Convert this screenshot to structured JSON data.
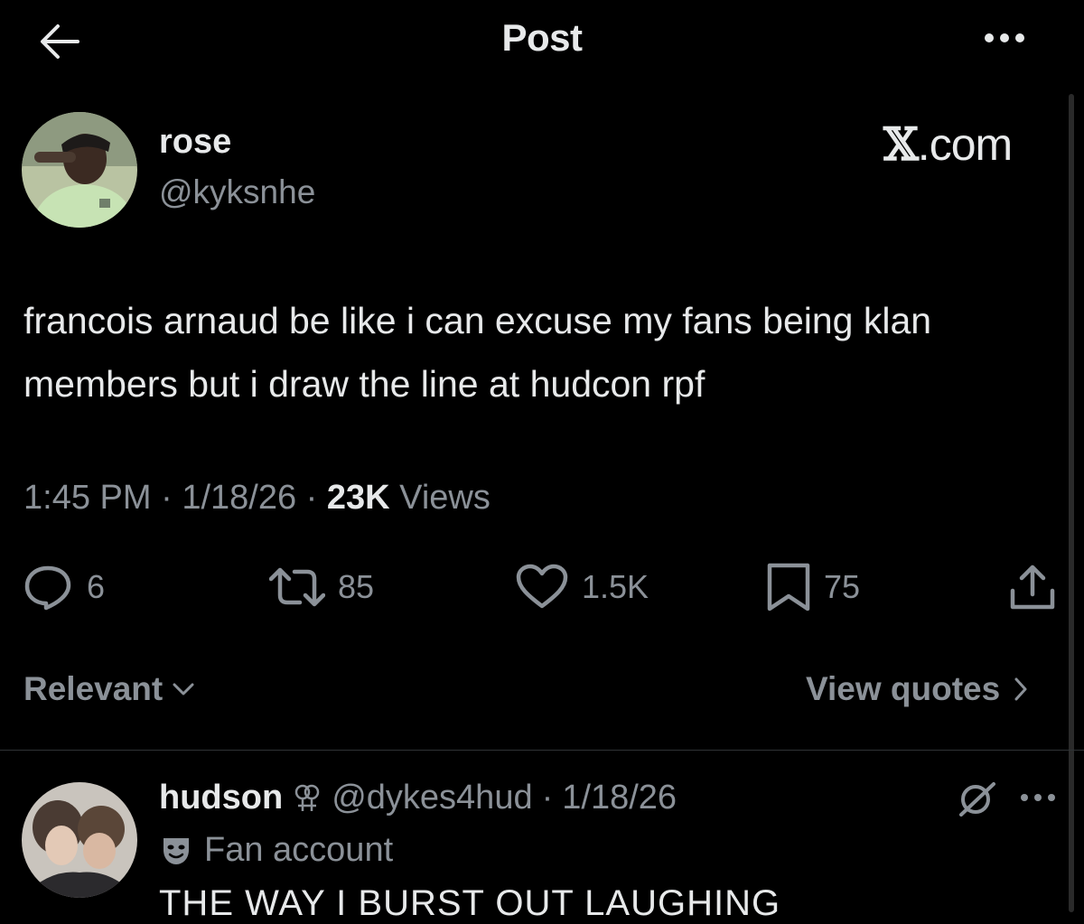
{
  "header": {
    "title": "Post"
  },
  "post": {
    "author_name": "rose",
    "author_handle": "@kyksnhe",
    "watermark": "X.com",
    "text": "francois arnaud be like i can excuse my fans being klan members but i draw the line at hudcon rpf",
    "time": "1:45 PM",
    "date": "1/18/26",
    "views_count": "23K",
    "views_label": "Views",
    "sep": "·",
    "actions": {
      "replies": "6",
      "reposts": "85",
      "likes": "1.5K",
      "bookmarks": "75"
    }
  },
  "sort": {
    "label": "Relevant"
  },
  "quotes": {
    "label": "View quotes"
  },
  "reply": {
    "author_name": "hudson",
    "author_handle": "@dykes4hud",
    "sep": "·",
    "date": "1/18/26",
    "badge_label": "Fan account",
    "text": "THE WAY I BURST OUT LAUGHING"
  },
  "colors": {
    "background": "#000000",
    "text": "#e7e9ea",
    "muted": "#8b9198",
    "divider": "#2f3336"
  }
}
